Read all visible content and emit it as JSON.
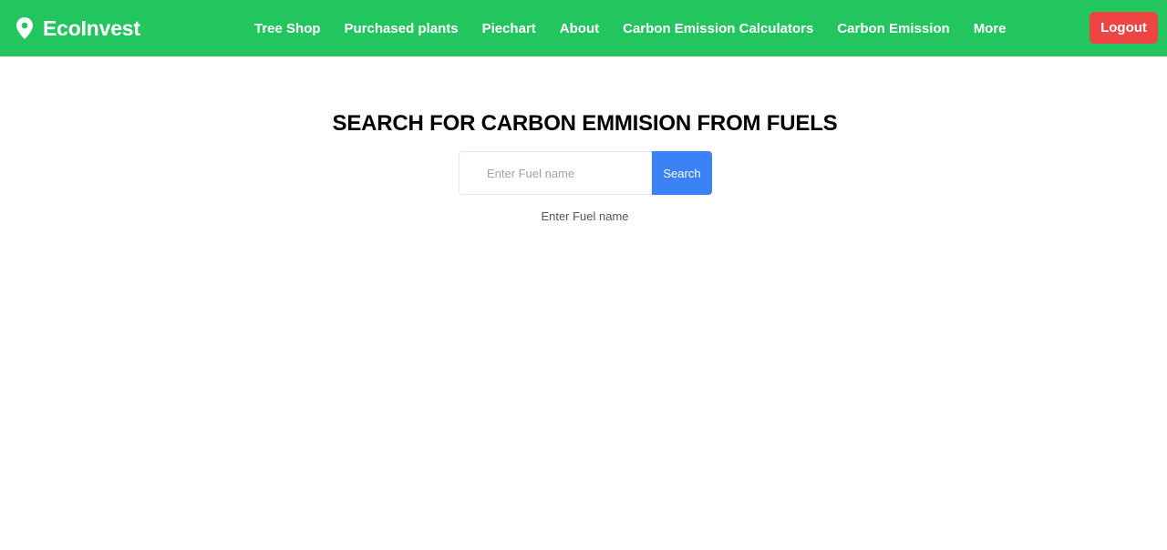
{
  "brand": {
    "name": "EcoInvest",
    "icon": "map-pin-icon"
  },
  "nav": {
    "links": [
      "Tree Shop",
      "Purchased plants",
      "Piechart",
      "About",
      "Carbon Emission Calculators",
      "Carbon Emission",
      "More"
    ],
    "logout_label": "Logout"
  },
  "main": {
    "title": "SEARCH FOR CARBON EMMISION FROM FUELS",
    "search": {
      "placeholder": "Enter Fuel name",
      "value": "",
      "button_label": "Search"
    },
    "result_text": "Enter Fuel name"
  },
  "colors": {
    "navbar": "#22c55e",
    "logout": "#ef4444",
    "search_button": "#3b82f6"
  }
}
